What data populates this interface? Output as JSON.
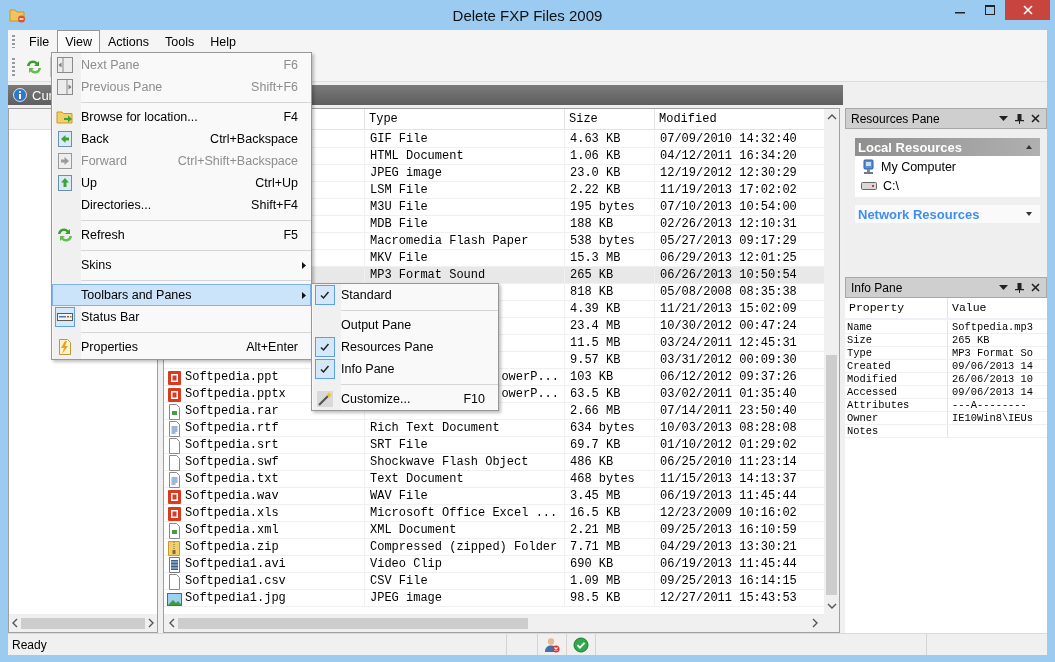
{
  "window": {
    "title": "Delete FXP Files 2009"
  },
  "menubar": [
    {
      "label": "File",
      "selected": false
    },
    {
      "label": "View",
      "selected": true
    },
    {
      "label": "Actions",
      "selected": false
    },
    {
      "label": "Tools",
      "selected": false
    },
    {
      "label": "Help",
      "selected": false
    }
  ],
  "location_bar": {
    "text": "Cur"
  },
  "file_list": {
    "columns": [
      "Type",
      "Size",
      "Modified"
    ],
    "rows": [
      {
        "type": "GIF File",
        "size": "4.63 KB",
        "modified": "07/09/2010 14:32:40",
        "selected": false,
        "covered": false
      },
      {
        "type": "HTML Document",
        "size": "1.06 KB",
        "modified": "04/12/2011 16:34:20",
        "selected": false,
        "covered": false
      },
      {
        "type": "JPEG image",
        "size": "23.0 KB",
        "modified": "12/19/2012 12:30:29",
        "selected": false,
        "covered": false
      },
      {
        "type": "LSM File",
        "size": "2.22 KB",
        "modified": "11/19/2013 17:02:02",
        "selected": false,
        "covered": false
      },
      {
        "type": "M3U File",
        "size": "195 bytes",
        "modified": "07/10/2013 10:54:00",
        "selected": false,
        "covered": false
      },
      {
        "type": "MDB File",
        "size": "188 KB",
        "modified": "02/26/2013 12:10:31",
        "selected": false,
        "covered": false
      },
      {
        "type": "Macromedia Flash Paper",
        "size": "538 bytes",
        "modified": "05/27/2013 09:17:29",
        "selected": false,
        "covered": false
      },
      {
        "type": "MKV File",
        "size": "15.3 MB",
        "modified": "06/29/2013 12:01:25",
        "selected": false,
        "covered": false
      },
      {
        "type": "MP3 Format Sound",
        "size": "265 KB",
        "modified": "06/26/2013 10:50:54",
        "selected": true,
        "covered": false
      },
      {
        "size": "818 KB",
        "modified": "05/08/2008 08:35:38",
        "selected": false
      },
      {
        "size": "4.39 KB",
        "modified": "11/21/2013 15:02:09",
        "selected": false
      },
      {
        "size": "23.4 MB",
        "modified": "10/30/2012 00:47:24",
        "selected": false
      },
      {
        "size": "11.5 MB",
        "modified": "03/24/2011 12:45:31",
        "selected": false
      },
      {
        "size": "9.57 KB",
        "modified": "03/31/2012 00:09:30",
        "selected": false
      },
      {
        "name": "Softpedia.ppt",
        "type": "owerP...",
        "size": "103 KB",
        "modified": "06/12/2012 09:37:26",
        "selected": false,
        "covered": true
      },
      {
        "name": "Softpedia.pptx",
        "type": "owerP...",
        "size": "63.5 KB",
        "modified": "03/02/2011 01:35:40",
        "selected": false,
        "covered": true
      },
      {
        "name": "Softpedia.rar",
        "size": "2.66 MB",
        "modified": "07/14/2011 23:50:40",
        "selected": false
      },
      {
        "name": "Softpedia.rtf",
        "type": "Rich Text Document",
        "size": "634 bytes",
        "modified": "10/03/2013 08:28:08",
        "selected": false,
        "covered": false
      },
      {
        "name": "Softpedia.srt",
        "type": "SRT File",
        "size": "69.7 KB",
        "modified": "01/10/2012 01:29:02",
        "selected": false,
        "covered": false
      },
      {
        "name": "Softpedia.swf",
        "type": "Shockwave Flash Object",
        "size": "486 KB",
        "modified": "06/25/2010 11:23:14",
        "selected": false,
        "covered": false
      },
      {
        "name": "Softpedia.txt",
        "type": "Text Document",
        "size": "468 bytes",
        "modified": "11/15/2013 14:13:37",
        "selected": false,
        "covered": false
      },
      {
        "name": "Softpedia.wav",
        "type": "WAV File",
        "size": "3.45 MB",
        "modified": "06/19/2013 11:45:44",
        "selected": false,
        "covered": false
      },
      {
        "name": "Softpedia.xls",
        "type": "Microsoft Office Excel ...",
        "size": "16.5 KB",
        "modified": "12/23/2009 10:16:02",
        "selected": false,
        "covered": false
      },
      {
        "name": "Softpedia.xml",
        "type": "XML Document",
        "size": "2.21 MB",
        "modified": "09/25/2013 16:10:59",
        "selected": false,
        "covered": false
      },
      {
        "name": "Softpedia.zip",
        "type": "Compressed (zipped) Folder",
        "size": "7.71 MB",
        "modified": "04/29/2013 13:30:21",
        "selected": false,
        "covered": false
      },
      {
        "name": "Softpedia1.avi",
        "type": "Video Clip",
        "size": "690 KB",
        "modified": "06/19/2013 11:45:44",
        "selected": false,
        "covered": false
      },
      {
        "name": "Softpedia1.csv",
        "type": "CSV File",
        "size": "1.09 MB",
        "modified": "09/25/2013 16:14:15",
        "selected": false,
        "covered": false
      },
      {
        "name": "Softpedia1.jpg",
        "type": "JPEG image",
        "size": "98.5 KB",
        "modified": "12/27/2011 15:43:53",
        "selected": false,
        "covered": false
      }
    ]
  },
  "resources_pane": {
    "title": "Resources Pane",
    "groups": [
      {
        "title": "Local Resources",
        "expanded": true,
        "items": [
          "My Computer",
          "C:\\"
        ]
      },
      {
        "title": "Network Resources",
        "expanded": false
      }
    ]
  },
  "info_pane": {
    "title": "Info Pane",
    "columns": [
      "Property",
      "Value"
    ],
    "rows": [
      {
        "property": "Name",
        "value": "Softpedia.mp3"
      },
      {
        "property": "Size",
        "value": "265 KB"
      },
      {
        "property": "Type",
        "value": "MP3 Format So"
      },
      {
        "property": "Created",
        "value": "09/06/2013 14"
      },
      {
        "property": "Modified",
        "value": "26/06/2013 10"
      },
      {
        "property": "Accessed",
        "value": "09/06/2013 14"
      },
      {
        "property": "Attributes",
        "value": "---A--------"
      },
      {
        "property": "Owner",
        "value": "IE10Win8\\IEUs"
      },
      {
        "property": "Notes"
      }
    ]
  },
  "view_menu": {
    "items": [
      {
        "kind": "item",
        "label": "Next Pane",
        "shortcut": "F6",
        "disabled": true,
        "checked": false,
        "selected": false
      },
      {
        "kind": "item",
        "label": "Previous Pane",
        "shortcut": "Shift+F6",
        "disabled": true,
        "checked": false,
        "selected": false
      },
      {
        "kind": "separator"
      },
      {
        "kind": "item",
        "label": "Browse for location...",
        "shortcut": "F4",
        "disabled": false,
        "checked": false,
        "selected": false
      },
      {
        "kind": "item",
        "label": "Back",
        "shortcut": "Ctrl+Backspace",
        "disabled": false,
        "checked": false,
        "selected": false
      },
      {
        "kind": "item",
        "label": "Forward",
        "shortcut": "Ctrl+Shift+Backspace",
        "disabled": true,
        "checked": false,
        "selected": false
      },
      {
        "kind": "item",
        "label": "Up",
        "shortcut": "Ctrl+Up",
        "disabled": false,
        "checked": false,
        "selected": false
      },
      {
        "kind": "item",
        "label": "Directories...",
        "shortcut": "Shift+F4",
        "disabled": false,
        "checked": false,
        "selected": false
      },
      {
        "kind": "separator"
      },
      {
        "kind": "item",
        "label": "Refresh",
        "shortcut": "F5",
        "disabled": false,
        "checked": false,
        "selected": false
      },
      {
        "kind": "separator"
      },
      {
        "kind": "submenu",
        "label": "Skins",
        "disabled": false,
        "checked": false,
        "selected": false
      },
      {
        "kind": "separator"
      },
      {
        "kind": "submenu",
        "label": "Toolbars and Panes",
        "disabled": false,
        "checked": false,
        "selected": true
      },
      {
        "kind": "item",
        "label": "Status Bar",
        "disabled": false,
        "checked": true,
        "selected": false
      },
      {
        "kind": "separator"
      },
      {
        "kind": "item",
        "label": "Properties",
        "shortcut": "Alt+Enter",
        "disabled": false,
        "checked": false,
        "selected": false
      }
    ]
  },
  "toolbars_submenu": {
    "items": [
      {
        "kind": "item",
        "label": "Standard",
        "disabled": false,
        "checked": true,
        "selected": false
      },
      {
        "kind": "separator"
      },
      {
        "kind": "item",
        "label": "Output Pane",
        "disabled": false,
        "checked": false,
        "selected": false
      },
      {
        "kind": "item",
        "label": "Resources Pane",
        "disabled": false,
        "checked": true,
        "selected": false
      },
      {
        "kind": "item",
        "label": "Info Pane",
        "disabled": false,
        "checked": true,
        "selected": false
      },
      {
        "kind": "separator"
      },
      {
        "kind": "item",
        "label": "Customize...",
        "shortcut": "F10",
        "disabled": false,
        "checked": false,
        "selected": false
      }
    ]
  },
  "status_bar": {
    "text": "Ready"
  }
}
